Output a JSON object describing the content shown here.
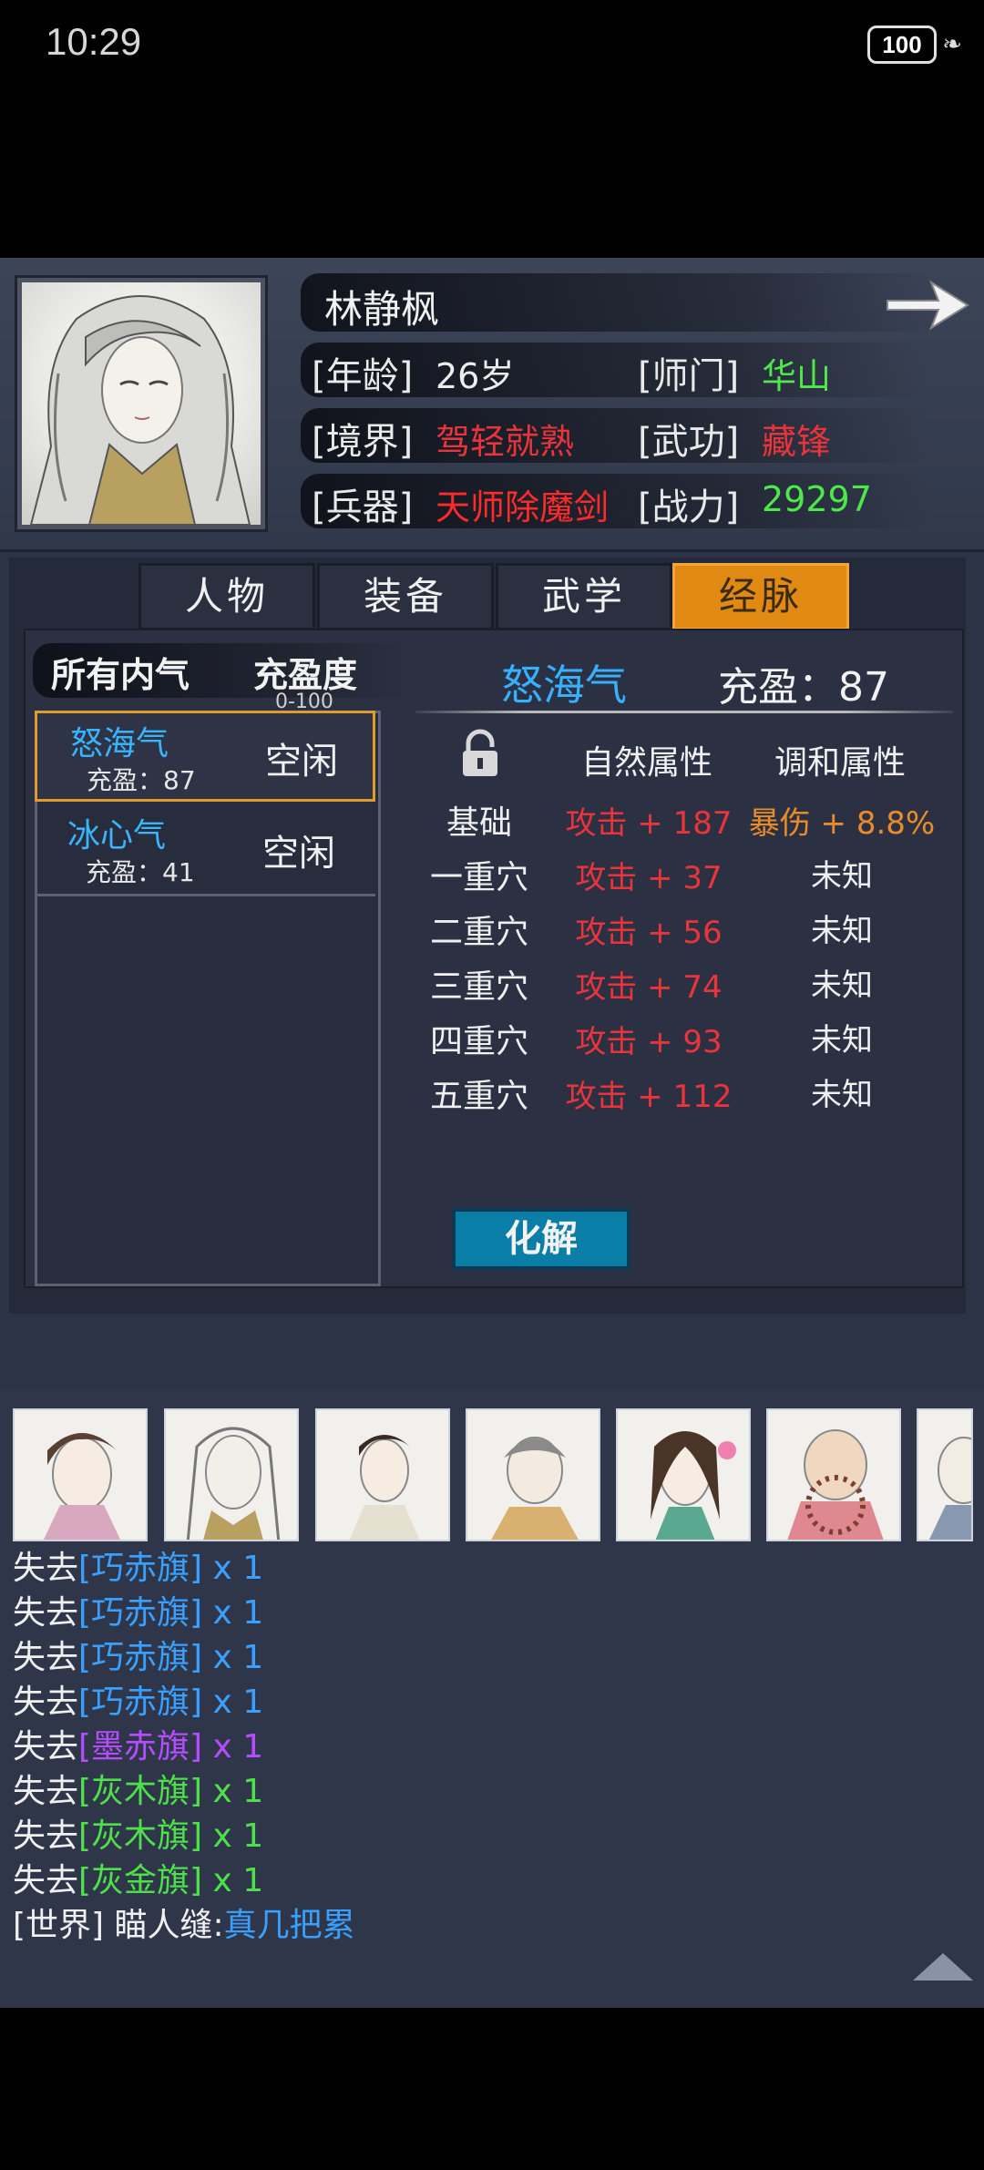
{
  "status": {
    "time": "10:29",
    "battery": "100"
  },
  "character": {
    "name": "林静枫",
    "labels": {
      "age": "[年龄]",
      "sect": "[师门]",
      "realm": "[境界]",
      "skill": "[武功]",
      "weapon": "[兵器]",
      "power": "[战力]"
    },
    "values": {
      "age": "26岁",
      "sect": "华山",
      "realm": "驾轻就熟",
      "skill": "藏锋",
      "weapon": "天师除魔剑",
      "power": "29297"
    },
    "colors": {
      "sect": "#4fe84a",
      "realm": "#e8343a",
      "skill": "#e8343a",
      "weapon": "#ff2a2a",
      "power": "#4fe84a"
    }
  },
  "tabs": [
    {
      "label": "人物",
      "active": false
    },
    {
      "label": "装备",
      "active": false
    },
    {
      "label": "武学",
      "active": false
    },
    {
      "label": "经脉",
      "active": true
    }
  ],
  "meridian": {
    "left_header": {
      "all": "所有内气",
      "fullness": "充盈度",
      "range": "0-100"
    },
    "items": [
      {
        "name": "怒海气",
        "fill": "充盈：87",
        "state": "空闲",
        "selected": true
      },
      {
        "name": "冰心气",
        "fill": "充盈：41",
        "state": "空闲",
        "selected": false
      }
    ],
    "detail": {
      "title": "怒海气",
      "fill": "充盈：87",
      "col_natural": "自然属性",
      "col_harmony": "调和属性",
      "rows": [
        {
          "label": "基础",
          "natural": "攻击 + 187",
          "harmony": "暴伤 + 8.8%"
        },
        {
          "label": "一重穴",
          "natural": "攻击 + 37",
          "harmony": "未知"
        },
        {
          "label": "二重穴",
          "natural": "攻击 + 56",
          "harmony": "未知"
        },
        {
          "label": "三重穴",
          "natural": "攻击 + 74",
          "harmony": "未知"
        },
        {
          "label": "四重穴",
          "natural": "攻击 + 93",
          "harmony": "未知"
        },
        {
          "label": "五重穴",
          "natural": "攻击 + 112",
          "harmony": "未知"
        }
      ],
      "harmony_base_color": "#e88c2a",
      "button": "化解"
    }
  },
  "chat": [
    {
      "prefix": "失去",
      "item": "[巧赤旗]",
      "qty": " x 1",
      "color": "blue"
    },
    {
      "prefix": "失去",
      "item": "[巧赤旗]",
      "qty": " x 1",
      "color": "blue"
    },
    {
      "prefix": "失去",
      "item": "[巧赤旗]",
      "qty": " x 1",
      "color": "blue"
    },
    {
      "prefix": "失去",
      "item": "[巧赤旗]",
      "qty": " x 1",
      "color": "blue"
    },
    {
      "prefix": "失去",
      "item": "[墨赤旗]",
      "qty": " x 1",
      "color": "purple"
    },
    {
      "prefix": "失去",
      "item": "[灰木旗]",
      "qty": " x 1",
      "color": "green"
    },
    {
      "prefix": "失去",
      "item": "[灰木旗]",
      "qty": " x 1",
      "color": "green"
    },
    {
      "prefix": "失去",
      "item": "[灰金旗]",
      "qty": " x 1",
      "color": "green"
    }
  ],
  "world_message": {
    "channel": "[世界]",
    "user": " 瞄人缝:",
    "text": "真几把累"
  }
}
